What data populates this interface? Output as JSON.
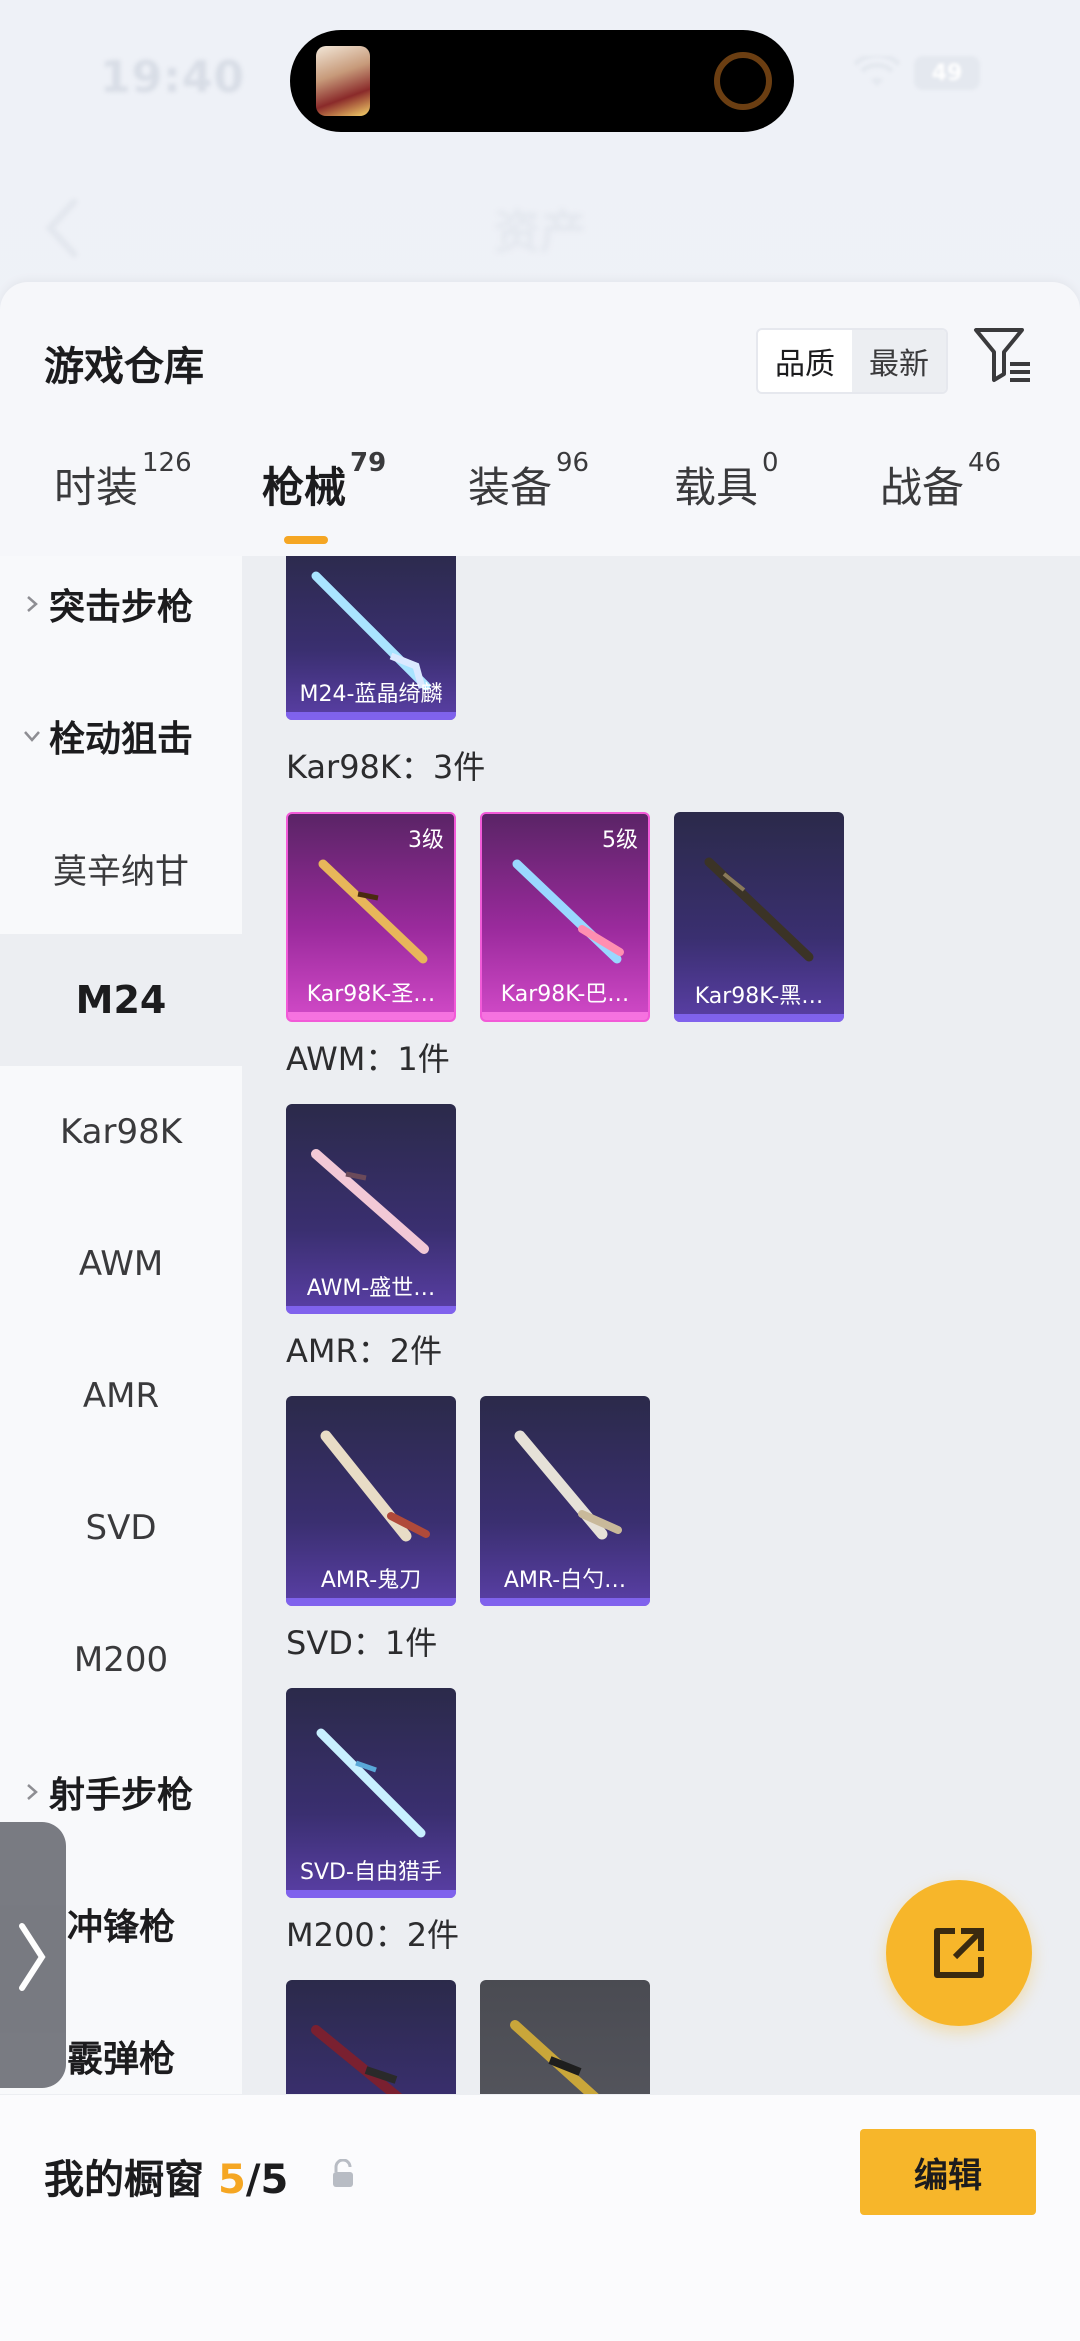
{
  "status_bar": {
    "time": "19:40",
    "battery": "49"
  },
  "nav": {
    "title": "资产"
  },
  "header": {
    "title": "游戏仓库",
    "sort_options": [
      "品质",
      "最新"
    ]
  },
  "tabs": [
    {
      "label": "时装",
      "count": "126"
    },
    {
      "label": "枪械",
      "count": "79",
      "active": true
    },
    {
      "label": "装备",
      "count": "96"
    },
    {
      "label": "载具",
      "count": "0"
    },
    {
      "label": "战备",
      "count": "46"
    }
  ],
  "sidebar": [
    {
      "label": "突击步枪",
      "type": "group-collapsed"
    },
    {
      "label": "栓动狙击",
      "type": "group-expanded"
    },
    {
      "label": "莫辛纳甘",
      "type": "sub"
    },
    {
      "label": "M24",
      "type": "sub",
      "selected": true
    },
    {
      "label": "Kar98K",
      "type": "sub"
    },
    {
      "label": "AWM",
      "type": "sub"
    },
    {
      "label": "AMR",
      "type": "sub"
    },
    {
      "label": "SVD",
      "type": "sub"
    },
    {
      "label": "M200",
      "type": "sub"
    },
    {
      "label": "射手步枪",
      "type": "group-collapsed"
    },
    {
      "label": "冲锋枪",
      "type": "group"
    },
    {
      "label": "霰弹枪",
      "type": "group"
    }
  ],
  "sections": [
    {
      "label": "",
      "items": [
        {
          "name": "M24-蓝晶绮麟",
          "style": "purple"
        }
      ]
    },
    {
      "label": "Kar98K：3件",
      "items": [
        {
          "name": "Kar98K-圣…",
          "level": "3级",
          "style": "pink"
        },
        {
          "name": "Kar98K-巴…",
          "level": "5级",
          "style": "pink"
        },
        {
          "name": "Kar98K-黑…",
          "style": "purple"
        }
      ]
    },
    {
      "label": "AWM：1件",
      "items": [
        {
          "name": "AWM-盛世…",
          "style": "purple"
        }
      ]
    },
    {
      "label": "AMR：2件",
      "items": [
        {
          "name": "AMR-鬼刀",
          "style": "purple"
        },
        {
          "name": "AMR-白勺…",
          "style": "purple"
        }
      ]
    },
    {
      "label": "SVD：1件",
      "items": [
        {
          "name": "SVD-自由猎手",
          "style": "purple"
        }
      ]
    },
    {
      "label": "M200：2件",
      "items": [
        {
          "name": "",
          "style": "purple"
        },
        {
          "name": "",
          "style": "gray"
        }
      ]
    }
  ],
  "bottom_bar": {
    "label": "我的橱窗",
    "current": "5",
    "total": "/5",
    "edit_label": "编辑"
  },
  "colors": {
    "accent": "#f7b62a",
    "pink_card": "#d24ac8",
    "purple_card": "#3a2f70"
  }
}
